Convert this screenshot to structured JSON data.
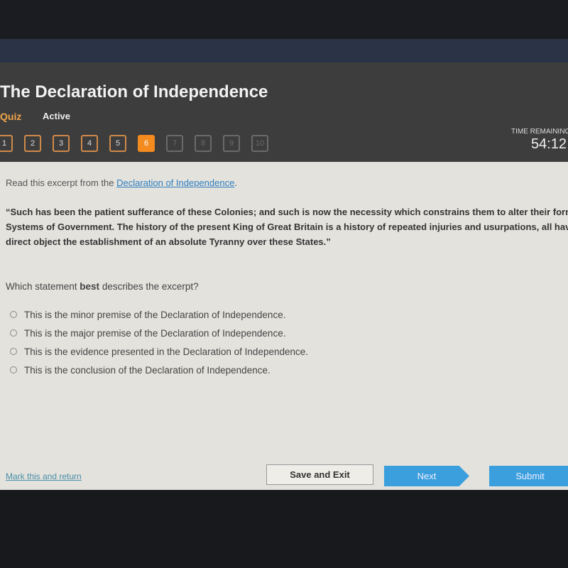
{
  "header": {
    "title": "The Declaration of Independence",
    "type": "Quiz",
    "status": "Active",
    "time_label": "TIME REMAINING",
    "time": "54:12"
  },
  "questions": [
    {
      "n": "1",
      "state": "answered"
    },
    {
      "n": "2",
      "state": "answered"
    },
    {
      "n": "3",
      "state": "answered"
    },
    {
      "n": "4",
      "state": "answered"
    },
    {
      "n": "5",
      "state": "answered"
    },
    {
      "n": "6",
      "state": "current"
    },
    {
      "n": "7",
      "state": "locked"
    },
    {
      "n": "8",
      "state": "locked"
    },
    {
      "n": "9",
      "state": "locked"
    },
    {
      "n": "10",
      "state": "locked"
    }
  ],
  "content": {
    "intro_prefix": "Read this excerpt from the ",
    "intro_link": "Declaration of Independence",
    "intro_suffix": ".",
    "passage": "“Such has been the patient sufferance of these Colonies; and such is now the necessity which constrains them to alter their former Systems of Government. The history of the present King of Great Britain is a history of repeated injuries and usurpations, all having in direct object the establishment of an absolute Tyranny over these States.”",
    "question_prefix": "Which statement ",
    "question_bold": "best",
    "question_suffix": " describes the excerpt?",
    "options": [
      "This is the minor premise of the Declaration of Independence.",
      "This is the major premise of the Declaration of Independence.",
      "This is the evidence presented in the Declaration of Independence.",
      "This is the conclusion of the Declaration of Independence."
    ]
  },
  "footer": {
    "mark": "Mark this and return",
    "save": "Save and Exit",
    "next": "Next",
    "submit": "Submit"
  },
  "colors": {
    "accent": "#f38b1f",
    "button": "#3a9fdc"
  }
}
